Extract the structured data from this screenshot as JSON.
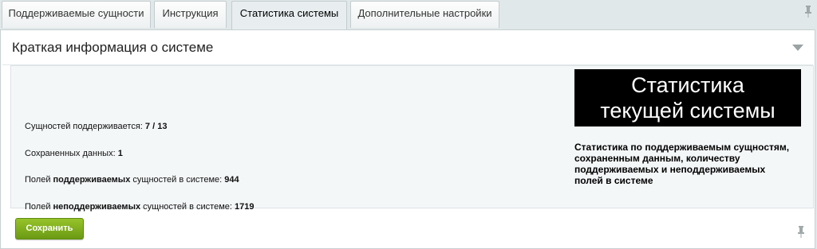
{
  "tabs": [
    {
      "label": "Поддерживаемые сущности"
    },
    {
      "label": "Инструкция"
    },
    {
      "label": "Статистика системы"
    },
    {
      "label": "Дополнительные настройки"
    }
  ],
  "active_tab": "Статистика системы",
  "panel": {
    "title": "Краткая информация о системе"
  },
  "stats": {
    "supported_entities_label": "Сущностей поддерживается:",
    "supported_entities_value": "7 / 13",
    "saved_data_label": "Сохраненных данных:",
    "saved_data_value": "1",
    "supported_fields_prefix": "Полей",
    "supported_fields_word": "поддерживаемых",
    "supported_fields_suffix": "сущностей в системе:",
    "supported_fields_value": "944",
    "unsupported_fields_prefix": "Полей",
    "unsupported_fields_word": "неподдерживаемых",
    "unsupported_fields_suffix": "сущностей в системе:",
    "unsupported_fields_value": "1719"
  },
  "hint": {
    "heading_line1": "Статистика",
    "heading_line2": "текущей системы",
    "body": "Статистика по поддерживаемым сущностям, сохраненным данным, количеству поддерживаемых и неподдерживаемых полей в системе"
  },
  "actions": {
    "save_label": "Сохранить"
  },
  "icons": {
    "pin": "pin-icon",
    "collapse": "chevron-down-icon"
  },
  "colors": {
    "save_button": "#7fae1d",
    "tab_bar": "#e0e8ea",
    "hint_heading_bg": "#000000"
  }
}
